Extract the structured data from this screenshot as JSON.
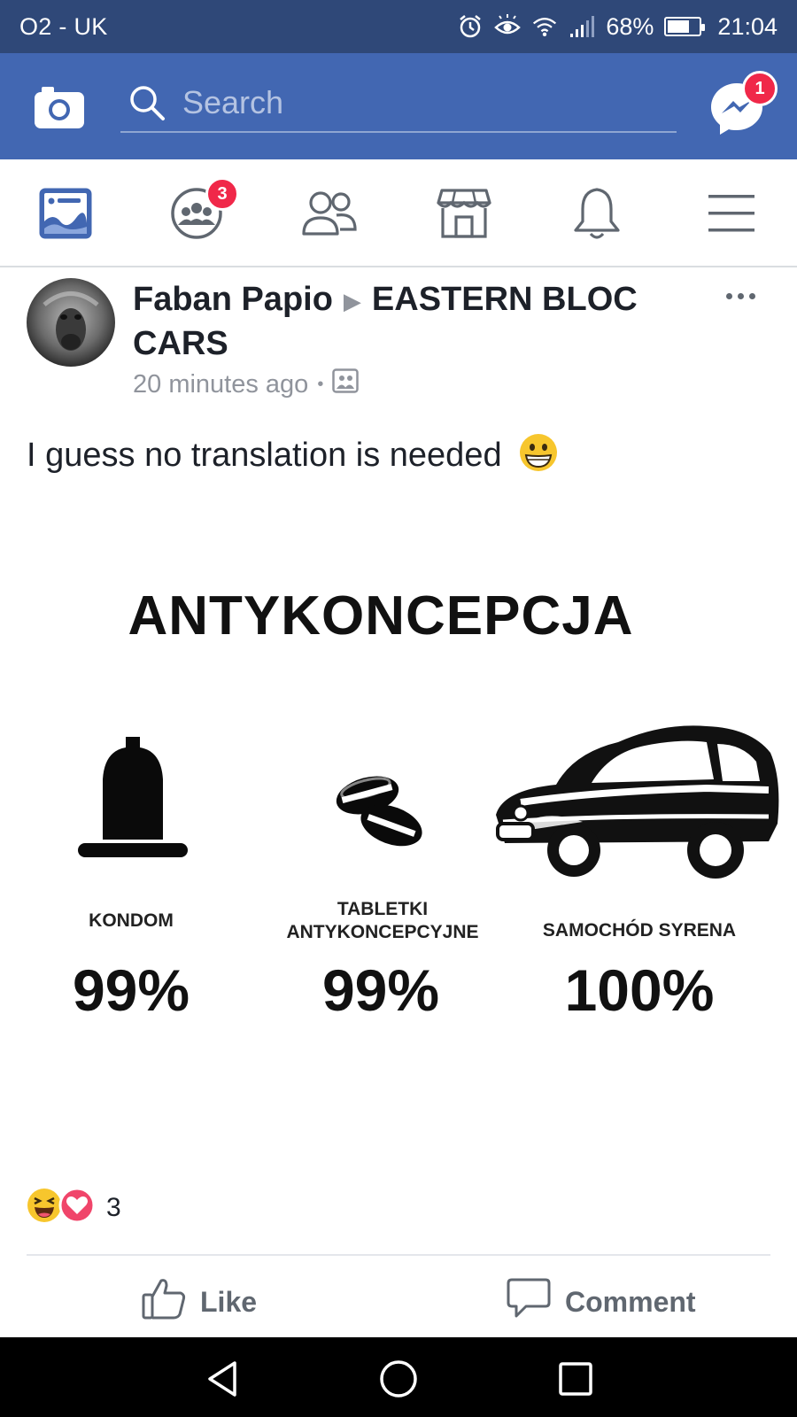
{
  "status_bar": {
    "carrier": "O2 - UK",
    "battery": "68%",
    "battery_level": 0.68,
    "time": "21:04",
    "icons": [
      "alarm-icon",
      "eye-icon",
      "wifi-icon",
      "signal-icon",
      "battery-icon"
    ]
  },
  "header": {
    "search_placeholder": "Search",
    "messenger_badge": "1",
    "brand_color": "#4267b2",
    "status_color": "#2f4878"
  },
  "tabs": [
    {
      "name": "news-feed",
      "icon": "news-feed-icon",
      "active": true
    },
    {
      "name": "groups",
      "icon": "groups-icon",
      "badge": "3"
    },
    {
      "name": "friends",
      "icon": "friends-icon"
    },
    {
      "name": "marketplace",
      "icon": "marketplace-icon"
    },
    {
      "name": "notifications",
      "icon": "bell-icon"
    },
    {
      "name": "menu",
      "icon": "hamburger-icon"
    }
  ],
  "post": {
    "author": "Faban Papio",
    "group": "EASTERN BLOC CARS",
    "time": "20 minutes ago",
    "separator": "•",
    "privacy_icon": "group-photo-icon",
    "text": "I guess no translation is needed",
    "emoji": "😁",
    "image": {
      "title": "ANTYKONCEPCJA",
      "items": [
        {
          "label_line1": "KONDOM",
          "label_line2": "",
          "percent": "99%",
          "icon": "condom-icon"
        },
        {
          "label_line1": "TABLETKI",
          "label_line2": "ANTYKONCEPCYJNE",
          "percent": "99%",
          "icon": "pills-icon"
        },
        {
          "label_line1": "SAMOCHÓD SYRENA",
          "label_line2": "",
          "percent": "100%",
          "icon": "car-icon"
        }
      ]
    },
    "reaction_count": "3",
    "actions": {
      "like": "Like",
      "comment": "Comment"
    }
  }
}
